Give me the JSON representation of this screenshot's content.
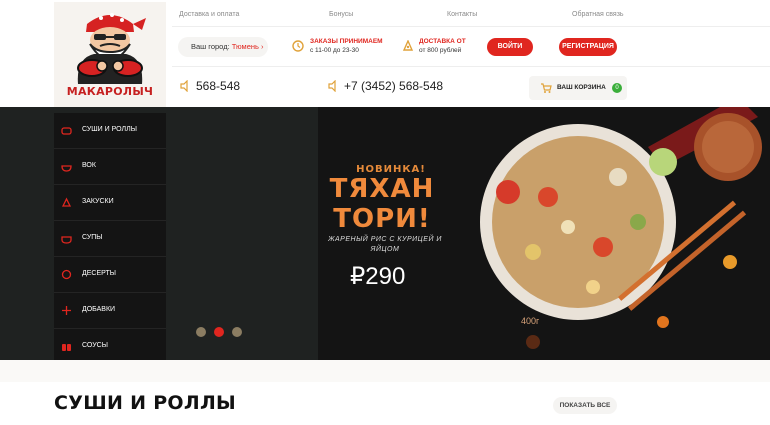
{
  "brand": {
    "name": "МАКАРОЛЫЧ"
  },
  "top_nav": [
    "Доставка и оплата",
    "Бонусы",
    "Контакты",
    "Обратная связь"
  ],
  "city": {
    "label": "Ваш город:",
    "value": "Тюмень",
    "icon": "chevron-right-icon"
  },
  "orders": {
    "title": "ЗАКАЗЫ ПРИНИМАЕМ",
    "hours": "с 11-00 до 23-30",
    "icon": "clock-icon"
  },
  "delivery": {
    "title": "ДОСТАВКА ОТ",
    "min": "от 800 рублей",
    "icon": "delivery-icon"
  },
  "buttons": {
    "login": "ВОЙТИ",
    "register": "РЕГИСТРАЦИЯ"
  },
  "phones": {
    "short": "568-548",
    "full": "+7 (3452) 568-548",
    "icon": "phone-icon"
  },
  "cart": {
    "label": "ВАШ КОРЗИНА",
    "count": "0",
    "icon": "cart-icon"
  },
  "menu": [
    {
      "label": "СУШИ И РОЛЛЫ",
      "icon": "sushi-icon"
    },
    {
      "label": "ВОК",
      "icon": "wok-icon"
    },
    {
      "label": "ЗАКУСКИ",
      "icon": "snack-icon"
    },
    {
      "label": "СУПЫ",
      "icon": "soup-icon"
    },
    {
      "label": "ДЕСЕРТЫ",
      "icon": "dessert-icon"
    },
    {
      "label": "ДОБАВКИ",
      "icon": "addons-icon"
    },
    {
      "label": "СОУСЫ",
      "icon": "sauce-icon"
    }
  ],
  "promo": {
    "badge": "НОВИНКА!",
    "title": "ТЯХАН\nТОРИ!",
    "subtitle": "ЖАРЕНЫЙ РИС С КУРИЦЕЙ И ЯЙЦОМ",
    "price": "₽290",
    "weight": "400г"
  },
  "slider": {
    "count": 3,
    "active": 2
  },
  "section": {
    "title": "СУШИ И РОЛЛЫ",
    "show_all": "ПОКАЗАТЬ ВСЕ"
  },
  "colors": {
    "accent": "#e0261f",
    "promo_orange": "#f08a3c",
    "menu_bg": "#141414",
    "cart_badge": "#3aae3a"
  }
}
